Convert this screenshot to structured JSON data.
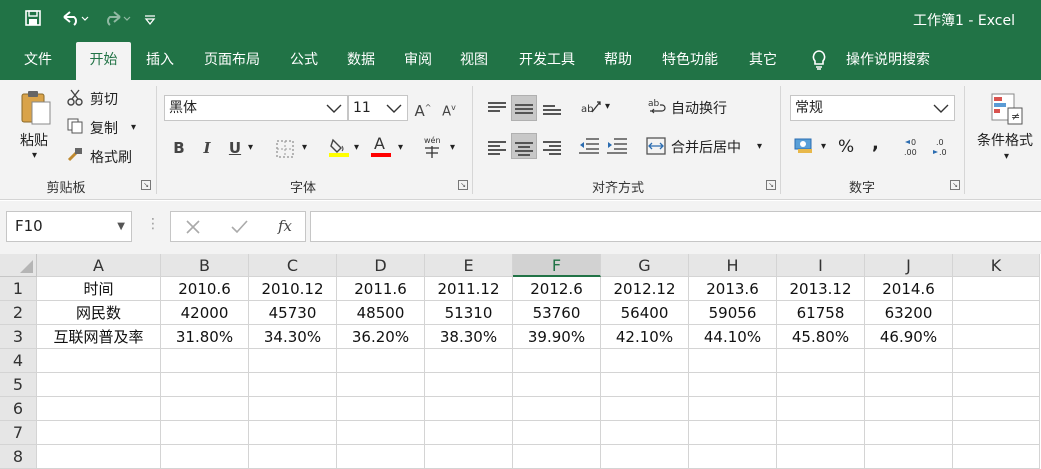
{
  "title": {
    "text": "工作簿1 - Excel",
    "qat": {
      "save_icon": "save-icon",
      "undo_icon": "undo-icon",
      "redo_icon": "redo-icon",
      "customize_icon": "customize-qat-icon"
    }
  },
  "tabs": [
    {
      "label": "文件"
    },
    {
      "label": "开始"
    },
    {
      "label": "插入"
    },
    {
      "label": "页面布局"
    },
    {
      "label": "公式"
    },
    {
      "label": "数据"
    },
    {
      "label": "审阅"
    },
    {
      "label": "视图"
    },
    {
      "label": "开发工具"
    },
    {
      "label": "帮助"
    },
    {
      "label": "特色功能"
    },
    {
      "label": "其它"
    },
    {
      "label": "操作说明搜索"
    }
  ],
  "active_tab": "开始",
  "ribbon": {
    "clipboard": {
      "paste": "粘贴",
      "cut": "剪切",
      "copy": "复制",
      "format_painter": "格式刷",
      "label": "剪贴板"
    },
    "font": {
      "font_name": "黑体",
      "font_size": "11",
      "bold": "B",
      "italic": "I",
      "underline": "U",
      "font_color": "A",
      "wen": "wén",
      "label": "字体",
      "highlight_color": "#ffff00",
      "font_color_bar": "#ff0000"
    },
    "alignment": {
      "wrap_text": "自动换行",
      "merge_center": "合并后居中",
      "label": "对齐方式"
    },
    "number": {
      "format": "常规",
      "percent": "%",
      "comma": ",",
      "label": "数字"
    },
    "styles": {
      "conditional": "条件格式"
    }
  },
  "formula_bar": {
    "name_box": "F10",
    "fx": "fx",
    "formula": ""
  },
  "sheet": {
    "columns": [
      "A",
      "B",
      "C",
      "D",
      "E",
      "F",
      "G",
      "H",
      "I",
      "J",
      "K"
    ],
    "selected_column": "F",
    "rows": [
      "1",
      "2",
      "3",
      "4",
      "5",
      "6",
      "7",
      "8"
    ],
    "cells": [
      [
        "时间",
        "2010.6",
        "2010.12",
        "2011.6",
        "2011.12",
        "2012.6",
        "2012.12",
        "2013.6",
        "2013.12",
        "2014.6",
        ""
      ],
      [
        "网民数",
        "42000",
        "45730",
        "48500",
        "51310",
        "53760",
        "56400",
        "59056",
        "61758",
        "63200",
        ""
      ],
      [
        "互联网普及率",
        "31.80%",
        "34.30%",
        "36.20%",
        "38.30%",
        "39.90%",
        "42.10%",
        "44.10%",
        "45.80%",
        "46.90%",
        ""
      ],
      [
        "",
        "",
        "",
        "",
        "",
        "",
        "",
        "",
        "",
        "",
        ""
      ],
      [
        "",
        "",
        "",
        "",
        "",
        "",
        "",
        "",
        "",
        "",
        ""
      ],
      [
        "",
        "",
        "",
        "",
        "",
        "",
        "",
        "",
        "",
        "",
        ""
      ],
      [
        "",
        "",
        "",
        "",
        "",
        "",
        "",
        "",
        "",
        "",
        ""
      ],
      [
        "",
        "",
        "",
        "",
        "",
        "",
        "",
        "",
        "",
        "",
        ""
      ]
    ]
  },
  "colors": {
    "accent": "#217346",
    "ribbon_bg": "#f3f3f3",
    "header_bg": "#e6e6e6",
    "gridline": "#d4d4d4"
  }
}
